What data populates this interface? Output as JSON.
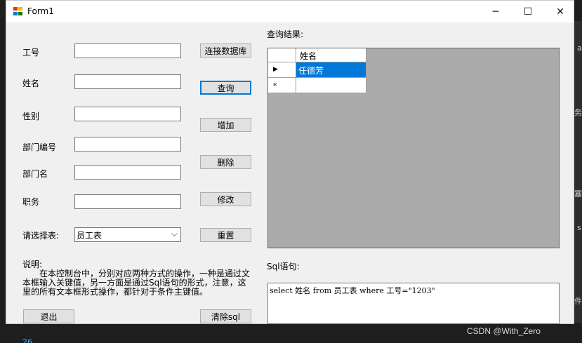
{
  "window": {
    "title": "Form1",
    "minimize": "─",
    "maximize": "☐",
    "close": "✕"
  },
  "labels": {
    "emp_id": "工号",
    "name": "姓名",
    "gender": "性别",
    "dept_id": "部门编号",
    "dept_name": "部门名",
    "position": "职务",
    "select_table": "请选择表:",
    "query_result": "查询结果:",
    "sql_statement": "Sql语句:"
  },
  "fields": {
    "emp_id": "",
    "name": "",
    "gender": "",
    "dept_id": "",
    "dept_name": "",
    "position": ""
  },
  "buttons": {
    "connect": "连接数据库",
    "query": "查询",
    "add": "增加",
    "delete": "删除",
    "modify": "修改",
    "reset": "重置",
    "exit": "退出",
    "clear_sql": "清除sql"
  },
  "combo": {
    "selected": "员工表",
    "arrow": "⌵"
  },
  "note": {
    "title": "说明:",
    "body": "在本控制台中，分别对应两种方式的操作，一种是通过文本框输入关键值，另一方面是通过Sql语句的形式，注意，这里的所有文本框形式操作，都针对于条件主键值。"
  },
  "grid": {
    "columns": [
      "姓名"
    ],
    "rows": [
      [
        "任德芳"
      ]
    ],
    "current_row_marker": "▶",
    "new_row_marker": "*"
  },
  "sql": {
    "text": "select 姓名 from 员工表 where 工号=\"1203\""
  },
  "background": {
    "watermark": "CSDN @With_Zero",
    "line_number": "26",
    "side_chars": [
      "a",
      "务",
      "塞",
      "s",
      "件"
    ]
  },
  "colors": {
    "selection": "#0078d7",
    "grid_bg": "#ababab",
    "form_bg": "#f0f0f0"
  }
}
